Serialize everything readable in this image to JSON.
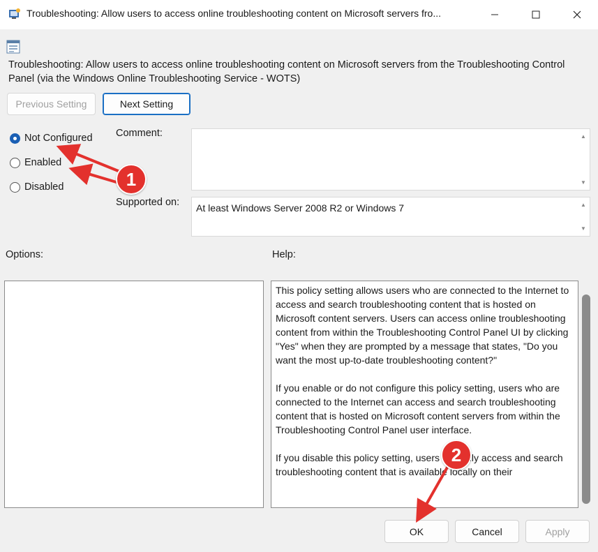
{
  "window": {
    "title": "Troubleshooting: Allow users to access online troubleshooting content on Microsoft servers fro...",
    "icon": "policy-icon"
  },
  "header": {
    "text": "Troubleshooting: Allow users to access online troubleshooting content on Microsoft servers from the Troubleshooting Control Panel (via the Windows Online Troubleshooting Service - WOTS)"
  },
  "nav": {
    "previous_label": "Previous Setting",
    "next_label": "Next Setting"
  },
  "state": {
    "options": [
      "Not Configured",
      "Enabled",
      "Disabled"
    ],
    "selected": "Not Configured"
  },
  "comment": {
    "label": "Comment:",
    "value": ""
  },
  "supported": {
    "label": "Supported on:",
    "value": "At least Windows Server 2008 R2 or Windows 7"
  },
  "options_label": "Options:",
  "help": {
    "label": "Help:",
    "text": "This policy setting allows users who are connected to the Internet to access and search troubleshooting content that is hosted on Microsoft content servers. Users can access online troubleshooting content from within the Troubleshooting Control Panel UI by clicking \"Yes\" when they are prompted by a message that states, \"Do you want the most up-to-date troubleshooting content?\"\n\nIf you enable or do not configure this policy setting, users who are connected to the Internet can access and search troubleshooting content that is hosted on Microsoft content servers from within the Troubleshooting Control Panel user interface.\n\nIf you disable this policy setting, users can only access and search troubleshooting content that is available locally on their"
  },
  "footer": {
    "ok_label": "OK",
    "cancel_label": "Cancel",
    "apply_label": "Apply"
  },
  "annotations": {
    "badge1": "1",
    "badge2": "2",
    "color": "#e3312d"
  }
}
